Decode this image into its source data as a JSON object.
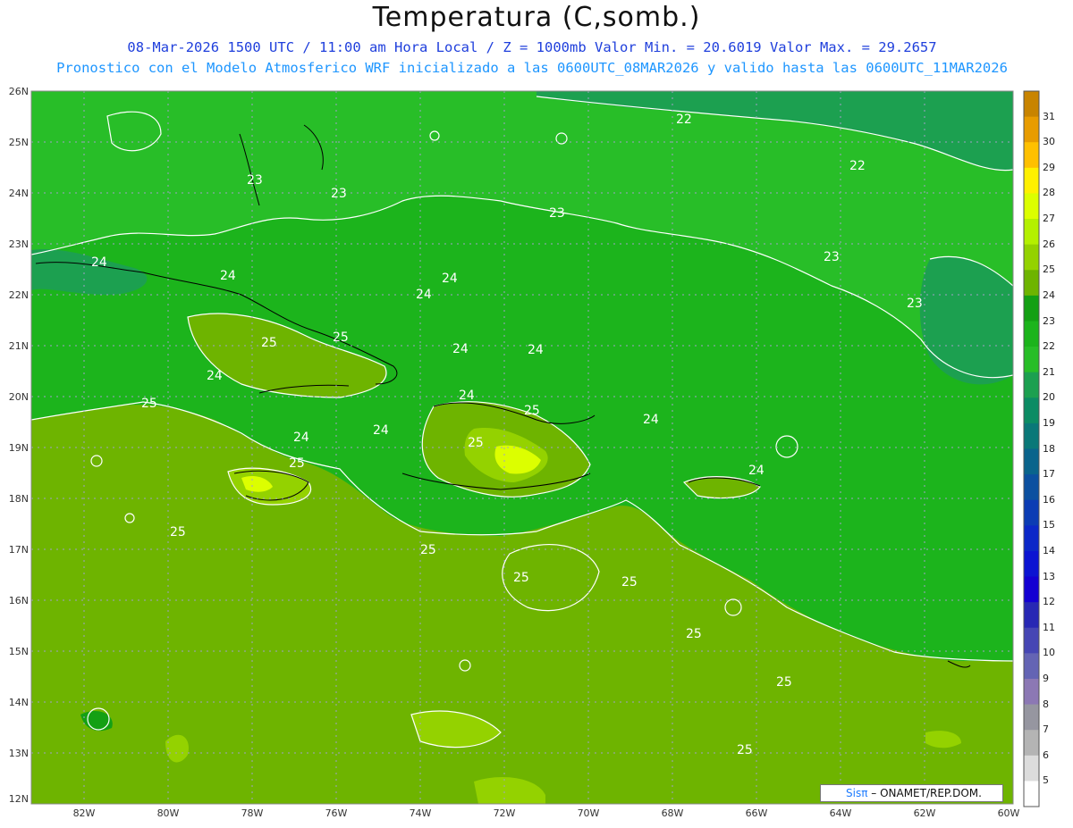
{
  "title": "Temperatura (C,somb.)",
  "subtitle_1": "08-Mar-2026 1500 UTC / 11:00 am Hora Local / Z = 1000mb   Valor Min. = 20.6019  Valor Max. = 29.2657",
  "subtitle_2": "Pronostico con el Modelo Atmosferico WRF inicializado a las 0600UTC_08MAR2026 y valido hasta las  0600UTC_11MAR2026",
  "lat_labels": [
    "26N",
    "25N",
    "24N",
    "23N",
    "22N",
    "21N",
    "20N",
    "19N",
    "18N",
    "17N",
    "16N",
    "15N",
    "14N",
    "13N",
    "12N"
  ],
  "lon_labels": [
    "82W",
    "80W",
    "78W",
    "76W",
    "74W",
    "72W",
    "70W",
    "68W",
    "66W",
    "64W",
    "62W",
    "60W"
  ],
  "colorbar": {
    "ticks": [
      "31",
      "30",
      "29",
      "28",
      "27",
      "26",
      "25",
      "24",
      "23",
      "22",
      "21",
      "20",
      "19",
      "18",
      "17",
      "16",
      "15",
      "14",
      "13",
      "12",
      "11",
      "10",
      "9",
      "8",
      "7",
      "6",
      "5"
    ],
    "colors": [
      "#c88400",
      "#e89c00",
      "#ffc000",
      "#fff000",
      "#dcff00",
      "#b4f000",
      "#94d200",
      "#6eb400",
      "#14a014",
      "#1cb41c",
      "#28be28",
      "#1ca050",
      "#0c8c64",
      "#0a7878",
      "#0a648c",
      "#0c50a0",
      "#0c3cb4",
      "#0c28c8",
      "#0c14d2",
      "#1400d2",
      "#2828b4",
      "#4646b4",
      "#6464b4",
      "#8c78b4",
      "#9696a0",
      "#b4b4b4",
      "#dcdcdc",
      "#ffffff"
    ]
  },
  "contour_labels": [
    "22",
    "22",
    "23",
    "23",
    "23",
    "23",
    "23",
    "24",
    "24",
    "24",
    "24",
    "24",
    "24",
    "24",
    "24",
    "24",
    "24",
    "24",
    "24",
    "25",
    "25",
    "25",
    "25",
    "25",
    "25",
    "25",
    "25",
    "25",
    "25",
    "25",
    "25",
    "25"
  ],
  "credit": {
    "logo": "Sisπ",
    "text": " – ONAMET/REP.DOM."
  }
}
